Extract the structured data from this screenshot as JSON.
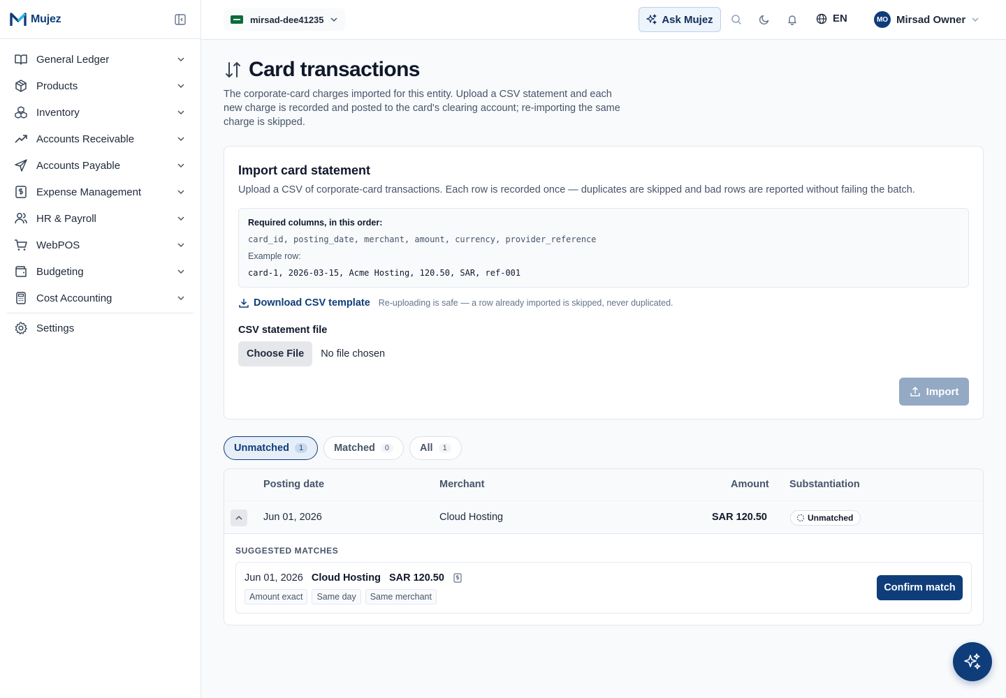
{
  "app": {
    "brand": "Mujez",
    "colors": {
      "primary": "#0f3d7a",
      "accent": "#2563eb",
      "muted": "#93a9c4"
    }
  },
  "sidebar": {
    "items": [
      {
        "label": "General Ledger",
        "icon": "book-open-icon"
      },
      {
        "label": "Products",
        "icon": "package-icon"
      },
      {
        "label": "Inventory",
        "icon": "boxes-icon"
      },
      {
        "label": "Accounts Receivable",
        "icon": "trending-up-icon"
      },
      {
        "label": "Accounts Payable",
        "icon": "send-icon"
      },
      {
        "label": "Expense Management",
        "icon": "receipt-icon"
      },
      {
        "label": "HR & Payroll",
        "icon": "users-icon"
      },
      {
        "label": "WebPOS",
        "icon": "cart-icon"
      },
      {
        "label": "Budgeting",
        "icon": "wallet-icon"
      },
      {
        "label": "Cost Accounting",
        "icon": "calculator-icon"
      }
    ],
    "settings_label": "Settings"
  },
  "topbar": {
    "entity": "mirsad-dee41235",
    "ask_label": "Ask Mujez",
    "language": "EN",
    "user_initials": "MO",
    "user_name": "Mirsad Owner"
  },
  "page": {
    "title": "Card transactions",
    "description": "The corporate-card charges imported for this entity. Upload a CSV statement and each new charge is recorded and posted to the card's clearing account; re-importing the same charge is skipped."
  },
  "import_card": {
    "title": "Import card statement",
    "description": "Upload a CSV of corporate-card transactions. Each row is recorded once — duplicates are skipped and bad rows are reported without failing the batch.",
    "required_heading": "Required columns, in this order:",
    "columns": "card_id, posting_date, merchant, amount, currency, provider_reference",
    "example_label": "Example row:",
    "example_row": "card-1, 2026-03-15, Acme Hosting, 120.50, SAR, ref-001",
    "download_label": "Download CSV template",
    "download_note": "Re-uploading is safe — a row already imported is skipped, never duplicated.",
    "file_label": "CSV statement file",
    "choose_label": "Choose File",
    "no_file": "No file chosen",
    "import_label": "Import"
  },
  "tabs": [
    {
      "label": "Unmatched",
      "count": "1",
      "active": true
    },
    {
      "label": "Matched",
      "count": "0",
      "active": false
    },
    {
      "label": "All",
      "count": "1",
      "active": false
    }
  ],
  "table": {
    "headers": {
      "posting_date": "Posting date",
      "merchant": "Merchant",
      "amount": "Amount",
      "substantiation": "Substantiation"
    },
    "rows": [
      {
        "posting_date": "Jun 01, 2026",
        "merchant": "Cloud Hosting",
        "amount": "SAR 120.50",
        "status": "Unmatched"
      }
    ],
    "suggested_title": "SUGGESTED MATCHES",
    "suggestion": {
      "date": "Jun 01, 2026",
      "merchant": "Cloud Hosting",
      "amount": "SAR 120.50",
      "chips": [
        "Amount exact",
        "Same day",
        "Same merchant"
      ],
      "confirm_label": "Confirm match"
    }
  }
}
